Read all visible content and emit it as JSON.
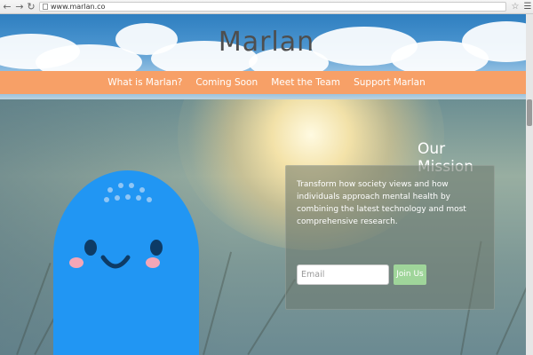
{
  "browser": {
    "url": "www.marlan.co",
    "back_icon": "back-arrow-icon",
    "forward_icon": "forward-arrow-icon",
    "reload_icon": "reload-icon",
    "bookmark_icon": "star-icon",
    "menu_icon": "menu-icon"
  },
  "header": {
    "logo": "Marlan"
  },
  "nav": {
    "items": [
      "What is Marlan?",
      "Coming Soon",
      "Meet the Team",
      "Support Marlan"
    ]
  },
  "hero": {
    "title": "Our Mission",
    "text": "Transform how society views and how individuals approach mental health by combining the latest technology and most comprehensive research.",
    "email_placeholder": "Email",
    "join_label": "Join Us"
  },
  "colors": {
    "nav_bg": "#f7a067",
    "mascot": "#2196f3",
    "join_button": "#9fd59a"
  }
}
